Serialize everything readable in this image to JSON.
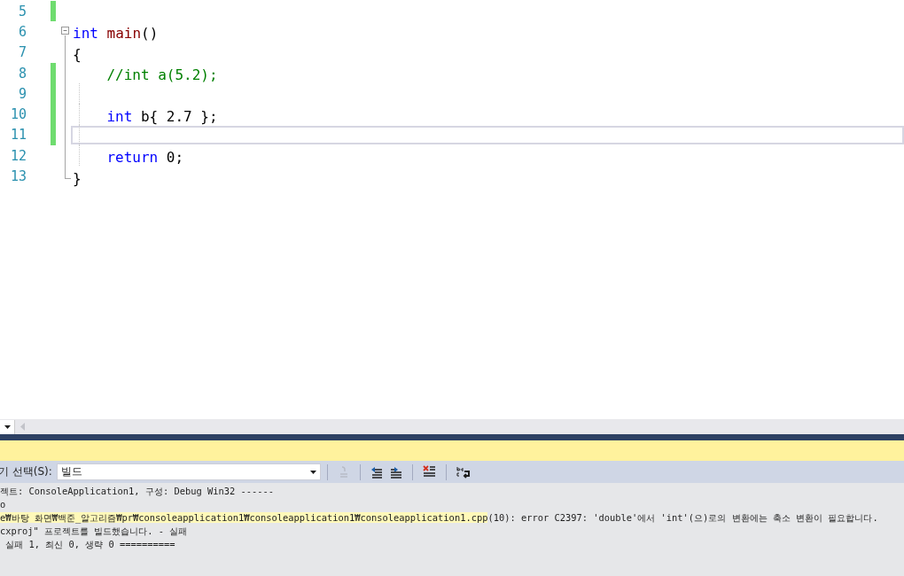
{
  "editor": {
    "lines": [
      {
        "number": "5",
        "changed": true,
        "current": false,
        "folding": false,
        "indented": false
      },
      {
        "number": "6",
        "changed": false,
        "current": false,
        "folding": true,
        "indented": false,
        "tokens": [
          {
            "kind": "keyword",
            "text": "int"
          },
          {
            "kind": "function",
            "text": " main"
          },
          {
            "kind": "plain",
            "text": "()"
          }
        ]
      },
      {
        "number": "7",
        "changed": false,
        "current": false,
        "folding": false,
        "indented": false,
        "tokens": [
          {
            "kind": "plain",
            "text": "{"
          }
        ]
      },
      {
        "number": "8",
        "changed": true,
        "current": false,
        "folding": false,
        "indented": true,
        "tokens": [
          {
            "kind": "comment",
            "text": "//int a(5.2);"
          }
        ]
      },
      {
        "number": "9",
        "changed": true,
        "current": false,
        "folding": false,
        "indented": false
      },
      {
        "number": "10",
        "changed": true,
        "current": false,
        "folding": false,
        "indented": true,
        "tokens": [
          {
            "kind": "keyword",
            "text": "int"
          },
          {
            "kind": "plain",
            "text": " b{ 2.7 };"
          }
        ]
      },
      {
        "number": "11",
        "changed": true,
        "current": true,
        "folding": false,
        "indented": false
      },
      {
        "number": "12",
        "changed": false,
        "current": false,
        "folding": false,
        "indented": true,
        "tokens": [
          {
            "kind": "keyword",
            "text": "return"
          },
          {
            "kind": "plain",
            "text": " 0;"
          }
        ]
      },
      {
        "number": "13",
        "changed": false,
        "current": false,
        "folding": false,
        "indented": false,
        "tokens": [
          {
            "kind": "plain",
            "text": "}"
          }
        ]
      }
    ]
  },
  "output": {
    "source_label": "기 선택(S):",
    "source_value": "빌드",
    "lines": [
      {
        "text": "젝트: ConsoleApplication1, 구성: Debug Win32 ------"
      },
      {
        "text": "o"
      },
      {
        "highlight": "e₩바탕 화면₩백준_알고리즘₩pr₩consoleapplication1₩consoleapplication1₩consoleapplication1.cpp",
        "text": "(10): error C2397: 'double'에서 'int'(으)로의 변환에는 축소 변환이 필요합니다."
      },
      {
        "text": "cxproj\" 프로젝트를 빌드했습니다. - 실패"
      },
      {
        "text": " 실패 1, 최신 0, 생략 0 =========="
      }
    ]
  }
}
